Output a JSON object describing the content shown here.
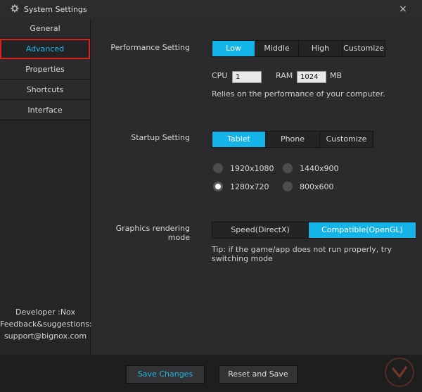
{
  "window": {
    "title": "System Settings",
    "close_glyph": "×"
  },
  "sidebar": {
    "items": [
      {
        "label": "General"
      },
      {
        "label": "Advanced"
      },
      {
        "label": "Properties"
      },
      {
        "label": "Shortcuts"
      },
      {
        "label": "Interface"
      }
    ],
    "active_index": 1,
    "info": {
      "developer": "Developer :Nox",
      "feedback": "Feedback&suggestions:",
      "email": "support@bignox.com"
    }
  },
  "performance": {
    "label": "Performance Setting",
    "options": [
      "Low",
      "Middle",
      "High",
      "Customize"
    ],
    "selected": "Low",
    "cpu_label": "CPU",
    "cpu_value": "1",
    "ram_label": "RAM",
    "ram_value": "1024",
    "ram_unit": "MB",
    "note": "Relies on the performance of your computer."
  },
  "startup": {
    "label": "Startup Setting",
    "options": [
      "Tablet",
      "Phone",
      "Customize"
    ],
    "selected": "Tablet",
    "resolutions": [
      "1920x1080",
      "1440x900",
      "1280x720",
      "800x600"
    ],
    "selected_resolution": "1280x720"
  },
  "graphics": {
    "label": "Graphics rendering mode",
    "options": [
      "Speed(DirectX)",
      "Compatible(OpenGL)"
    ],
    "selected": "Compatible(OpenGL)",
    "tip_line1": "Tip: if the game/app does not run properly, try",
    "tip_line2": "switching mode"
  },
  "footer": {
    "save_label": "Save Changes",
    "reset_label": "Reset and Save"
  },
  "colors": {
    "accent": "#14b4e8",
    "highlight_box": "#d8231f"
  },
  "icons": {
    "title": "gear-icon",
    "close": "close-icon"
  }
}
